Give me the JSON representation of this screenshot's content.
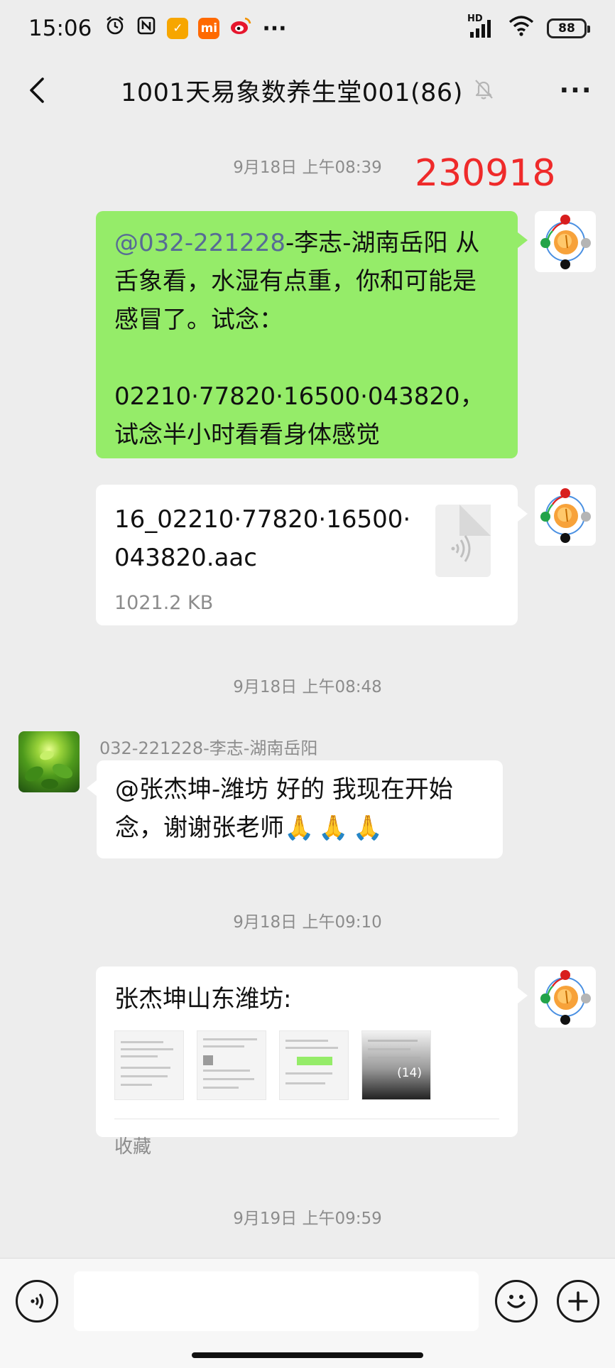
{
  "status_bar": {
    "time": "15:06",
    "app_icons": [
      "alarm-icon",
      "nfc-icon",
      "cash-app-icon",
      "mi-icon",
      "weibo-icon"
    ],
    "more": "···",
    "network": "HD",
    "battery": "88"
  },
  "header": {
    "title": "1001天易象数养生堂001(86)",
    "muted": true,
    "more": "···"
  },
  "messages": {
    "ts1": "9月18日 上午08:39",
    "stamp": "230918",
    "msg1": {
      "mention": "@032-221228",
      "line1_rest": "-李志-湖南岳阳  从",
      "line2": "舌象看，水湿有点重，你和可能是",
      "line3": "感冒了。试念：",
      "line4": "02210·77820·16500·043820，",
      "line5": "试念半小时看看身体感觉"
    },
    "file": {
      "name_line1": "16_02210·77820·16500·",
      "name_line2": "043820.aac",
      "size": "1021.2 KB"
    },
    "ts2": "9月18日 上午08:48",
    "msg2": {
      "sender": "032-221228-李志-湖南岳阳",
      "line1": "@张杰坤-潍坊  好的 我现在开始",
      "line2": "念，谢谢张老师",
      "emoji": "🙏🙏🙏"
    },
    "ts3": "9月18日 上午09:10",
    "msg3": {
      "title": "张杰坤山东潍坊:",
      "count": "(14)",
      "fav_label": "收藏"
    },
    "ts4": "9月19日 上午09:59"
  },
  "input_bar": {
    "placeholder": ""
  },
  "colors": {
    "chat_bg": "#ededed",
    "self_bubble": "#95ec69",
    "other_bubble": "#ffffff",
    "mention": "#576b95",
    "stamp_red": "#ef2a2a"
  }
}
